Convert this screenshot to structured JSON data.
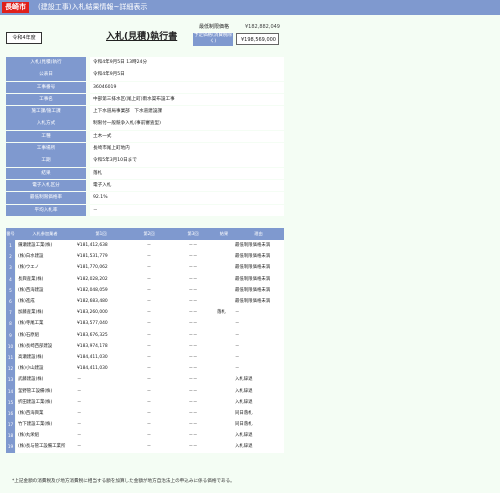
{
  "header": {
    "city": "長崎市",
    "title": "(建設工事)入札結果情報~詳細表示"
  },
  "year_label": "令和4年度",
  "heading": "入札(見積)執行書",
  "price": {
    "cap_label": "最低制限価格",
    "cap_value": "¥182,882,049",
    "est_label": "予定価格(消費税除く)",
    "est_value": "¥198,569,000"
  },
  "info": [
    {
      "label": "入札(見積)執行",
      "value": "令和4年9月5日 13時24分"
    },
    {
      "label": "公表日",
      "value": "令和4年9月5日"
    },
    {
      "label": "工事番号",
      "value": "36046019"
    },
    {
      "label": "工事名",
      "value": "中部第三排水区(尾上町)雨水渠布設工事"
    },
    {
      "label": "施工課/施工課",
      "value": "上下水道局事業部　下水道建設課"
    },
    {
      "label": "入札方式",
      "value": "制限付一般競争入札(事前審査型)"
    },
    {
      "label": "工種",
      "value": "土木一式"
    },
    {
      "label": "工事場所",
      "value": "長崎市尾上町地内"
    },
    {
      "label": "工期",
      "value": "令和5年3月10日まで"
    },
    {
      "label": "結果",
      "value": "落札"
    },
    {
      "label": "電子入札区分",
      "value": "電子入札"
    },
    {
      "label": "最低制限価格率",
      "value": "92.1%"
    },
    {
      "label": "平均入札率",
      "value": "－"
    }
  ],
  "bid_table": {
    "headers": [
      "番号",
      "入札参加業者",
      "第1回",
      "第2回",
      "第3回",
      "結果",
      "理由"
    ],
    "rows": [
      {
        "no": "1",
        "name": "鎌瀬建設工業(株)",
        "r1": "¥181,412,638",
        "r2": "－",
        "r3": "－－",
        "result": "",
        "reason": "最低制限価格未満"
      },
      {
        "no": "2",
        "name": "(株)白水建設",
        "r1": "¥181,531,779",
        "r2": "－",
        "r3": "－－",
        "result": "",
        "reason": "最低制限価格未満"
      },
      {
        "no": "3",
        "name": "(株)ウエノ",
        "r1": "¥181,770,062",
        "r2": "－",
        "r3": "－－",
        "result": "",
        "reason": "最低制限価格未満"
      },
      {
        "no": "4",
        "name": "長興産業(株)",
        "r1": "¥182,028,202",
        "r2": "－",
        "r3": "－－",
        "result": "",
        "reason": "最低制限価格未満"
      },
      {
        "no": "5",
        "name": "(株)西海建設",
        "r1": "¥182,048,059",
        "r2": "－",
        "r3": "－－",
        "result": "",
        "reason": "最低制限価格未満"
      },
      {
        "no": "6",
        "name": "(株)進成",
        "r1": "¥182,683,480",
        "r2": "－",
        "r3": "－－",
        "result": "",
        "reason": "最低制限価格未満"
      },
      {
        "no": "7",
        "name": "加藤産業(株)",
        "r1": "¥183,260,000",
        "r2": "－",
        "r3": "－－",
        "result": "落札",
        "reason": "－"
      },
      {
        "no": "8",
        "name": "(株)寺尾工業",
        "r1": "¥183,577,040",
        "r2": "－",
        "r3": "－－",
        "result": "",
        "reason": "－"
      },
      {
        "no": "9",
        "name": "(株)石原組",
        "r1": "¥183,676,325",
        "r2": "－",
        "r3": "－－",
        "result": "",
        "reason": "－"
      },
      {
        "no": "10",
        "name": "(株)長崎西部建設",
        "r1": "¥183,974,178",
        "r2": "－",
        "r3": "－－",
        "result": "",
        "reason": "－"
      },
      {
        "no": "11",
        "name": "高瀬建設(株)",
        "r1": "¥184,411,030",
        "r2": "－",
        "r3": "－－",
        "result": "",
        "reason": "－"
      },
      {
        "no": "12",
        "name": "(株)小山建設",
        "r1": "¥184,411,030",
        "r2": "－",
        "r3": "－－",
        "result": "",
        "reason": "－"
      },
      {
        "no": "13",
        "name": "武藤建設(株)",
        "r1": "－",
        "r2": "－",
        "r3": "－－",
        "result": "",
        "reason": "入札辞退"
      },
      {
        "no": "14",
        "name": "釜野管工設備(株)",
        "r1": "－",
        "r2": "－",
        "r3": "－－",
        "result": "",
        "reason": "入札辞退"
      },
      {
        "no": "15",
        "name": "折田建設工業(株)",
        "r1": "－",
        "r2": "－",
        "r3": "－－",
        "result": "",
        "reason": "入札辞退"
      },
      {
        "no": "16",
        "name": "(株)西海興業",
        "r1": "－",
        "r2": "－",
        "r3": "－－",
        "result": "",
        "reason": "同日落札"
      },
      {
        "no": "17",
        "name": "竹下建設工業(株)",
        "r1": "－",
        "r2": "－",
        "r3": "－－",
        "result": "",
        "reason": "同日落札"
      },
      {
        "no": "18",
        "name": "(株)丸栄組",
        "r1": "－",
        "r2": "－",
        "r3": "－－",
        "result": "",
        "reason": "入札辞退"
      },
      {
        "no": "19",
        "name": "(株)長与管工設備工業所",
        "r1": "－",
        "r2": "－",
        "r3": "－－",
        "result": "",
        "reason": "入札辞退"
      }
    ]
  },
  "footnote": "*上記金額の消費税及び地方消費税に相当する額を加算した金額が地方自治法上の申込みに係る価格である。",
  "colors": {
    "accent": "#7f99cf",
    "city_badge": "#e0201a",
    "background": "#f4fdf4"
  }
}
